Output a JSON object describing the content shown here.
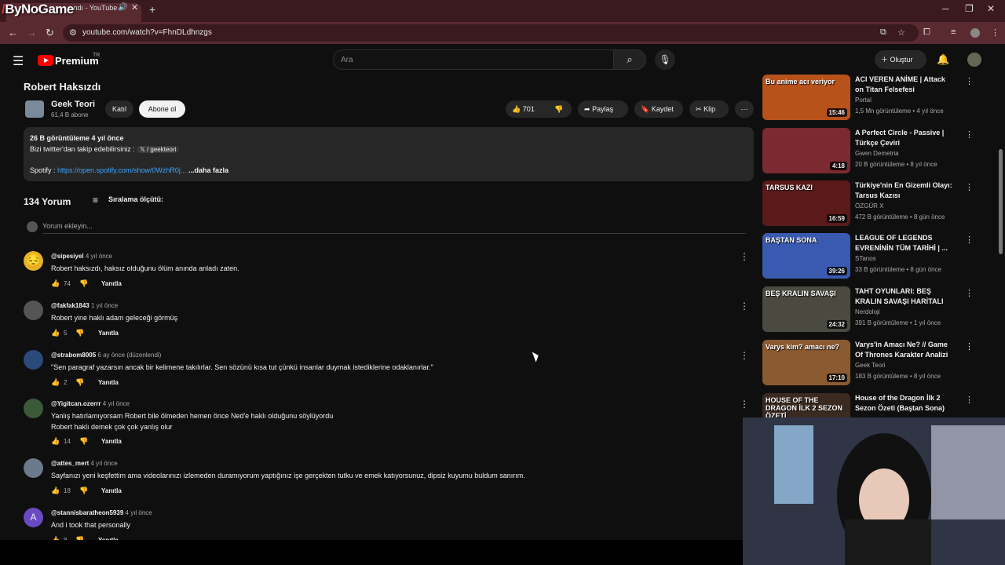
{
  "watermark": {
    "text": "ByNoGame"
  },
  "browser": {
    "tab_title": "...ndı - YouTube",
    "url": "youtube.com/watch?v=FhnDLdhnzgs",
    "new_tab_icon": "+",
    "close_icon": "✕"
  },
  "yt": {
    "brand": "Premium",
    "region": "TR",
    "search_placeholder": "Ara",
    "create_label": "Oluştur"
  },
  "video": {
    "title": "Robert Haksızdı",
    "channel": "Geek Teori",
    "subs": "61,4 B abone",
    "join_label": "Katıl",
    "subscribe_label": "Abone ol",
    "likes": "701",
    "share_label": "Paylaş",
    "save_label": "Kaydet",
    "clip_label": "Klip"
  },
  "description": {
    "meta": "26 B görüntüleme  4 yıl önce",
    "line1": "Bizi twitter'dan takip edebilirsiniz :",
    "twitter_tag": "𝕏 / geekteori",
    "spotify_label": "Spotify :",
    "spotify_link": "https://open.spotify.com/show/0WzhR0j...",
    "more": "...daha fazla"
  },
  "comments_section": {
    "count_label": "134 Yorum",
    "sort_label": "Sıralama ölçütü:",
    "add_placeholder": "Yorum ekleyin..."
  },
  "comments": [
    {
      "author": "@sipesiyel",
      "time": "4 yıl önce",
      "text": "Robert haksızdı, haksız olduğunu ölüm anında anladı zaten.",
      "likes": "74",
      "reply": "Yanıtla"
    },
    {
      "author": "@fakfak1843",
      "time": "1 yıl önce",
      "text": "Robert yine haklı adam geleceği görmüş",
      "likes": "5",
      "reply": "Yanıtla"
    },
    {
      "author": "@strabom8005",
      "time": "6 ay önce (düzenlendi)",
      "text": "\"Sen paragraf yazarsın ancak bir kelimene takılırlar. Sen sözünü kısa tut çünkü insanlar duymak istediklerine odaklanırlar.\"",
      "likes": "2",
      "reply": "Yanıtla"
    },
    {
      "author": "@Yigitcan.ozerrr",
      "time": "4 yıl önce",
      "text": "Yanlış hatırlamıyorsam Robert bile ölmeden hemen önce Ned'e haklı olduğunu söylüyordu",
      "text2": "Robert haklı demek çok çok yanlış olur",
      "likes": "14",
      "reply": "Yanıtla"
    },
    {
      "author": "@attes_mert",
      "time": "4 yıl önce",
      "text": "Sayfanızı yeni keşfettim ama videolarınızı izlemeden duramıyorum yaptığınız işe gerçekten tutku ve emek katıyorsunuz, dipsiz kuyumu buldum sanırım.",
      "likes": "18",
      "reply": "Yanıtla"
    },
    {
      "author": "@stannisbaratheon5939",
      "time": "4 yıl önce",
      "text": "And i took that personally",
      "likes": "8",
      "reply": "Yanıtla",
      "avatar_letter": "A"
    }
  ],
  "recommendations": [
    {
      "title": "ACI VEREN ANİME | Attack on Titan Felsefesi",
      "channel": "Portal",
      "meta": "1,5 Mn görüntüleme • 4 yıl önce",
      "duration": "15:46",
      "thumb_text": "Bu anime acı veriyor",
      "color": "#b8521b"
    },
    {
      "title": "A Perfect Circle - Passive | Türkçe Çeviri",
      "channel": "Gwen Demetria",
      "meta": "20 B görüntüleme • 8 yıl önce",
      "duration": "4:18",
      "thumb_text": "",
      "color": "#7a2a30"
    },
    {
      "title": "Türkiye'nin En Gizemli Olayı: Tarsus Kazısı",
      "channel": "ÖZGÜR X",
      "meta": "472 B görüntüleme • 8 gün önce",
      "duration": "16:59",
      "thumb_text": "TARSUS KAZI",
      "color": "#5a1a1a"
    },
    {
      "title": "LEAGUE OF LEGENDS EVRENİNİN TÜM TARİHİ | ...",
      "channel": "STanos",
      "meta": "33 B görüntüleme • 8 gün önce",
      "duration": "39:26",
      "thumb_text": "BAŞTAN SONA",
      "color": "#3a5ab0"
    },
    {
      "title": "TAHT OYUNLARI: BEŞ KRALIN SAVAŞI HARİTALI ANLATIM ...",
      "channel": "Nerdoloji",
      "meta": "391 B görüntüleme • 1 yıl önce",
      "duration": "24:32",
      "thumb_text": "BEŞ KRALIN SAVAŞI",
      "color": "#4a4a40"
    },
    {
      "title": "Varys'in Amacı Ne? // Game Of Thrones Karakter Analizi",
      "channel": "Geek Teori",
      "meta": "183 B görüntüleme • 8 yıl önce",
      "duration": "17:10",
      "thumb_text": "Varys kim? amacı ne?",
      "color": "#8a5a30"
    },
    {
      "title": "House of the Dragon İlk 2 Sezon Özeti (Baştan Sona)",
      "channel": "",
      "meta": "",
      "duration": "",
      "thumb_text": "HOUSE OF THE DRAGON İLK 2 SEZON ÖZETİ",
      "color": "#3a2a20"
    }
  ]
}
